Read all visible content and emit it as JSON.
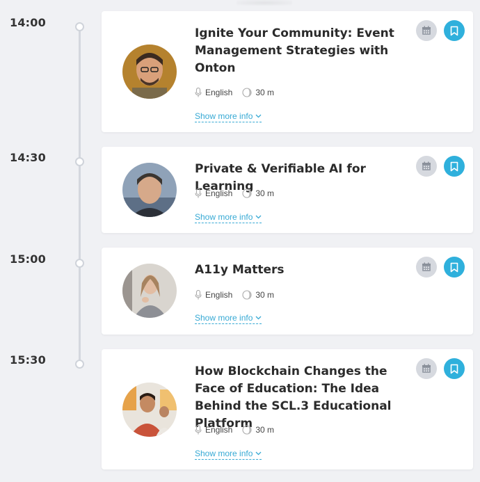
{
  "sessions": [
    {
      "time": "14:00",
      "title": "Ignite Your Community: Event Management Strategies with Onton",
      "language": "English",
      "duration": "30 m",
      "show_more": "Show more info",
      "avatar_color": "#b5822e"
    },
    {
      "time": "14:30",
      "title": "Private & Verifiable AI for Learning",
      "language": "English",
      "duration": "30 m",
      "show_more": "Show more info",
      "avatar_color": "#8a9ab0"
    },
    {
      "time": "15:00",
      "title": "A11y Matters",
      "language": "English",
      "duration": "30 m",
      "show_more": "Show more info",
      "avatar_color": "#cfc8c0"
    },
    {
      "time": "15:30",
      "title": "How Blockchain Changes the Face of Education: The Idea Behind the SCL.3 Educational Platform",
      "language": "English",
      "duration": "30 m",
      "show_more": "Show more info",
      "avatar_color": "#c9533a"
    }
  ],
  "colors": {
    "accent": "#2fb0dc",
    "link": "#36a9d4",
    "calendar_button": "#d6d9df",
    "background": "#f0f1f4"
  },
  "icons": {
    "language": "microphone-icon",
    "duration": "clock-icon",
    "calendar": "calendar-icon",
    "bookmark": "bookmark-icon",
    "expand": "chevron-down-icon"
  }
}
